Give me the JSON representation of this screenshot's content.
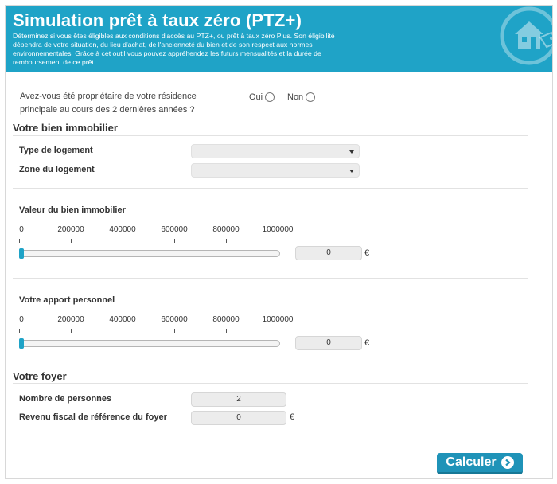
{
  "header": {
    "title": "Simulation prêt à taux zéro (PTZ+)",
    "description": "Déterminez si vous êtes éligibles aux conditions d'accès au PTZ+, ou prêt à taux zéro Plus. Son éligibilité dépendra de votre situation, du lieu d'achat, de l'ancienneté du bien et de son respect aux normes environnementales. Grâce à cet outil vous pouvez appréhendez les futurs mensualités et la durée de remboursement de ce prêt.",
    "icon": "house-tag-icon",
    "bg_color": "#1fa3c7"
  },
  "ownership": {
    "question": "Avez-vous été propriétaire de votre résidence principale au cours des 2 dernières années ?",
    "option_yes": "Oui",
    "option_no": "Non"
  },
  "bien": {
    "section_title": "Votre bien immobilier",
    "type_label": "Type de logement",
    "type_value": "",
    "zone_label": "Zone du logement",
    "zone_value": ""
  },
  "valeur": {
    "label": "Valeur du bien immobilier",
    "ticks": [
      "0",
      "200000",
      "400000",
      "600000",
      "800000",
      "1000000"
    ],
    "value": "0",
    "currency": "€",
    "slider_fraction": 0
  },
  "apport": {
    "label": "Votre apport personnel",
    "ticks": [
      "0",
      "200000",
      "400000",
      "600000",
      "800000",
      "1000000"
    ],
    "value": "0",
    "currency": "€",
    "slider_fraction": 0
  },
  "foyer": {
    "section_title": "Votre foyer",
    "persons_label": "Nombre de personnes",
    "persons_value": "2",
    "revenu_label": "Revenu fiscal de référence du foyer",
    "revenu_value": "0",
    "currency": "€"
  },
  "submit": {
    "label": "Calculer",
    "icon": "arrow-right-circle-icon",
    "color": "#1f93b8"
  }
}
